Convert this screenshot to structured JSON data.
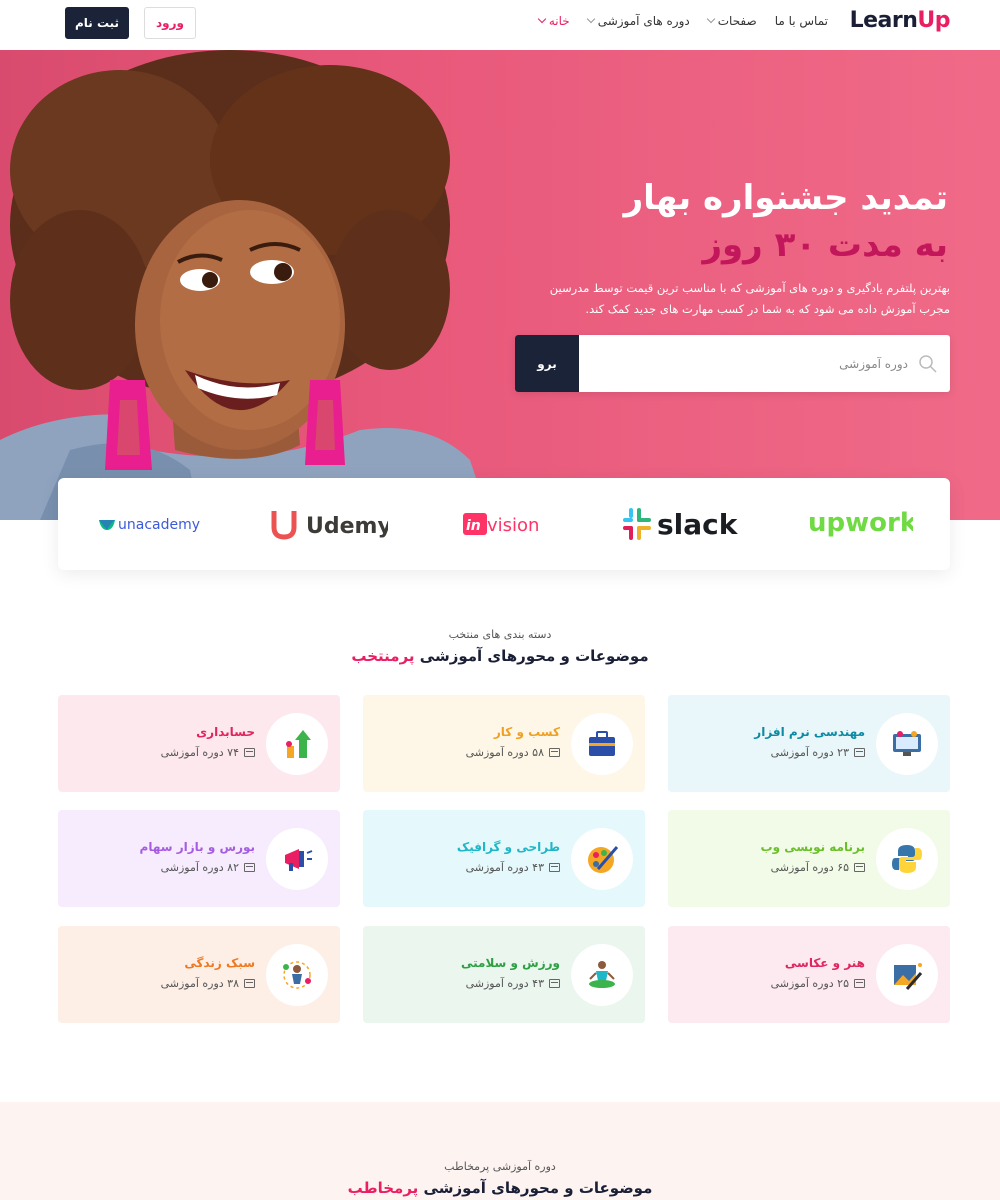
{
  "header": {
    "logo_part1": "Learn",
    "logo_part2": "Up",
    "nav": [
      {
        "label": "خانه",
        "dropdown": true,
        "active": true
      },
      {
        "label": "دوره های آموزشی",
        "dropdown": true,
        "active": false
      },
      {
        "label": "صفحات",
        "dropdown": true,
        "active": false
      },
      {
        "label": "تماس با ما",
        "dropdown": false,
        "active": false
      }
    ],
    "login_label": "ورود",
    "register_label": "ثبت نام"
  },
  "hero": {
    "title": "تمدید جشنواره بهار",
    "subtitle": "به مدت ۳۰ روز",
    "description": "بهترین پلتفرم یادگیری و دوره های آموزشی که با مناسب ترین قیمت توسط مدرسین مجرب آموزش داده می شود که به شما در کسب مهارت های جدید کمک کند.",
    "search_placeholder": "دوره آموزشی",
    "search_button": "برو"
  },
  "brands": [
    "upwork",
    "slack",
    "invision",
    "Udemy",
    "unacademy"
  ],
  "categories_section": {
    "caption": "دسته بندی های منتخب",
    "title_main": "موضوعات و محورهای آموزشی",
    "title_accent": "پرمنتخب"
  },
  "categories": [
    {
      "name": "مهندسی نرم افزار",
      "count": "۲۳ دوره آموزشی",
      "name_color": "#0c8aa3",
      "bg": "#e9f6fa",
      "icon": "software-engineering-icon"
    },
    {
      "name": "کسب و کار",
      "count": "۵۸ دوره آموزشی",
      "name_color": "#f0a020",
      "bg": "#fef7e7",
      "icon": "briefcase-icon"
    },
    {
      "name": "حسابداری",
      "count": "۷۴ دوره آموزشی",
      "name_color": "#e0245e",
      "bg": "#fde8ee",
      "icon": "accounting-chart-icon"
    },
    {
      "name": "برنامه نویسی وب",
      "count": "۶۵ دوره آموزشی",
      "name_color": "#6bbf2a",
      "bg": "#f2fbe8",
      "icon": "python-icon"
    },
    {
      "name": "طراحی و گرافیک",
      "count": "۴۳ دوره آموزشی",
      "name_color": "#1fb6c8",
      "bg": "#e5f8fb",
      "icon": "palette-icon"
    },
    {
      "name": "بورس و بازار سهام",
      "count": "۸۲ دوره آموزشی",
      "name_color": "#a65ce0",
      "bg": "#f6ecfd",
      "icon": "stock-market-icon"
    },
    {
      "name": "هنر و عکاسی",
      "count": "۲۵ دوره آموزشی",
      "name_color": "#e0245e",
      "bg": "#fde9f0",
      "icon": "art-photo-icon"
    },
    {
      "name": "ورزش و سلامتی",
      "count": "۴۳ دوره آموزشی",
      "name_color": "#2ea043",
      "bg": "#eaf6ee",
      "icon": "yoga-icon"
    },
    {
      "name": "سبک زندگی",
      "count": "۳۸ دوره آموزشی",
      "name_color": "#f07820",
      "bg": "#fdefe6",
      "icon": "lifestyle-icon"
    }
  ],
  "popular_section": {
    "caption": "دوره آموزشی پرمخاطب",
    "title_main": "موضوعات و محورهای آموزشی",
    "title_accent": "پرمخاطب"
  }
}
